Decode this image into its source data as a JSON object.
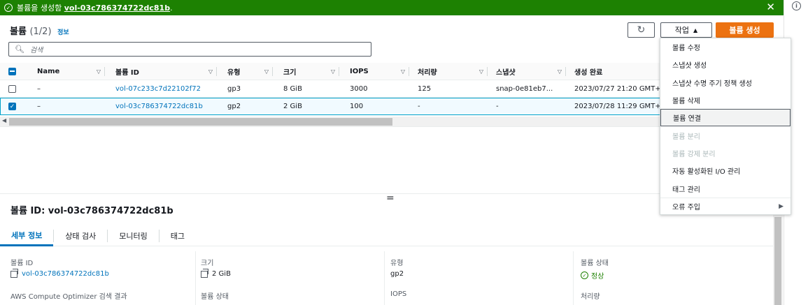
{
  "banner": {
    "prefix": "볼륨을 생성함 ",
    "volume_link": "vol-03c786374722dc81b",
    "suffix": ".",
    "close": "✕"
  },
  "header": {
    "title": "볼륨",
    "count": "(1/2)",
    "info": "정보",
    "actions_label": "작업",
    "create_label": "볼륨 생성"
  },
  "search": {
    "placeholder": "검색"
  },
  "table": {
    "columns": [
      "Name",
      "볼륨 ID",
      "유형",
      "크기",
      "IOPS",
      "처리량",
      "스냅샷",
      "생성 완료"
    ],
    "rows": [
      {
        "checked": false,
        "name": "–",
        "volume_id": "vol-07c233c7d22102f72",
        "type": "gp3",
        "size": "8 GiB",
        "iops": "3000",
        "throughput": "125",
        "snapshot": "snap-0e81eb7...",
        "created": "2023/07/27 21:20 GMT+"
      },
      {
        "checked": true,
        "name": "–",
        "volume_id": "vol-03c786374722dc81b",
        "type": "gp2",
        "size": "2 GiB",
        "iops": "100",
        "throughput": "-",
        "snapshot": "-",
        "created": "2023/07/28 11:29 GMT+"
      }
    ]
  },
  "menu": {
    "items": [
      {
        "label": "볼륨 수정",
        "disabled": false
      },
      {
        "label": "스냅샷 생성",
        "disabled": false
      },
      {
        "label": "스냅샷 수명 주기 정책 생성",
        "disabled": false
      },
      {
        "label": "볼륨 삭제",
        "disabled": false
      },
      {
        "label": "볼륨 연결",
        "disabled": false,
        "highlighted": true
      },
      {
        "label": "볼륨 분리",
        "disabled": true
      },
      {
        "label": "볼륨 강제 분리",
        "disabled": true
      },
      {
        "label": "자동 활성화된 I/O 관리",
        "disabled": false
      },
      {
        "label": "태그 관리",
        "disabled": false
      },
      {
        "label": "오류 주입",
        "disabled": false,
        "submenu": true
      }
    ]
  },
  "details": {
    "title": "볼륨 ID: vol-03c786374722dc81b",
    "tabs": [
      "세부 정보",
      "상태 검사",
      "모니터링",
      "태그"
    ],
    "fields": {
      "volume_id_label": "볼륨 ID",
      "volume_id_value": "vol-03c786374722dc81b",
      "size_label": "크기",
      "size_value": "2 GiB",
      "type_label": "유형",
      "type_value": "gp2",
      "state_label": "볼륨 상태",
      "state_value": "정상",
      "optimizer_label": "AWS Compute Optimizer 검색 결과",
      "volume_state2_label": "볼륨 상태",
      "iops_label": "IOPS",
      "throughput_label": "처리량"
    }
  },
  "colors": {
    "success": "#1d8102",
    "primary": "#ec7211",
    "link": "#0073bb"
  }
}
